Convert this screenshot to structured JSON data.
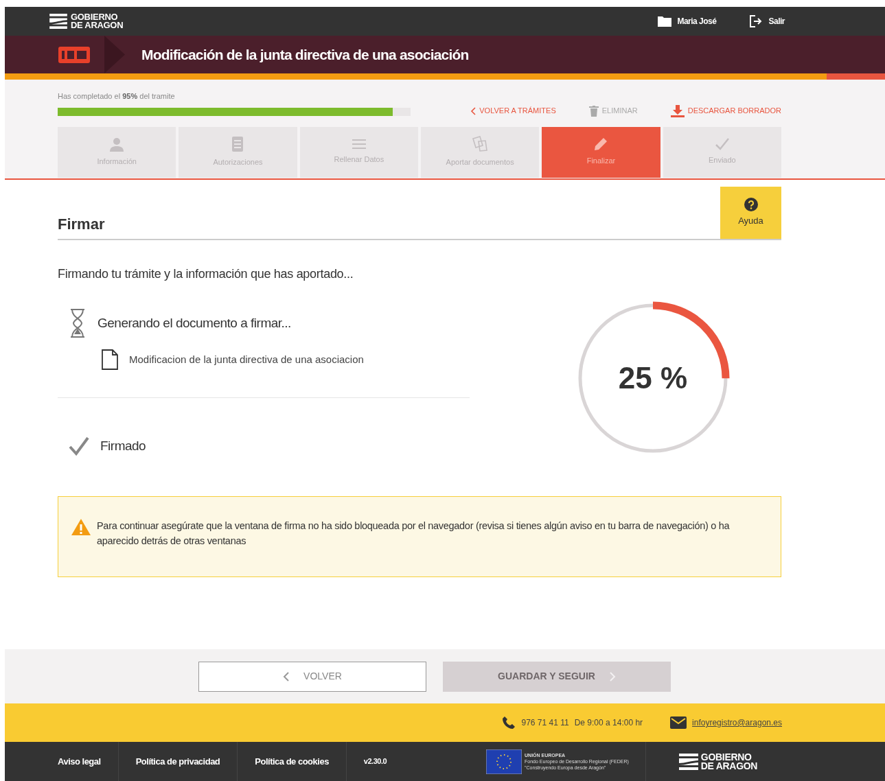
{
  "header": {
    "logo_line1": "GOBIERNO",
    "logo_line2": "DE ARAGON",
    "user": "Maria José",
    "logout": "Salir"
  },
  "title_bar": {
    "title": "Modificación de la junta directiva de una asociación"
  },
  "progress": {
    "text_before": "Has completado el ",
    "percent": "95%",
    "text_after": " del tramite",
    "level": 0.95
  },
  "actions": [
    {
      "kind": "back",
      "label": "VOLVER A TRÁMITES",
      "disabled": false
    },
    {
      "kind": "delete",
      "label": "ELIMINAR",
      "disabled": true
    },
    {
      "kind": "download",
      "label": "DESCARGAR BORRADOR",
      "disabled": false
    }
  ],
  "steps": [
    {
      "kind": "user",
      "label": "Información",
      "selected": false
    },
    {
      "kind": "doc",
      "label": "Autorizaciones",
      "selected": false
    },
    {
      "kind": "lines",
      "label": "Rellenar Datos",
      "selected": false
    },
    {
      "kind": "papers",
      "label": "Aportar documentos",
      "selected": false
    },
    {
      "kind": "pencil",
      "label": "Finalizar",
      "selected": true
    },
    {
      "kind": "check",
      "label": "Enviado",
      "selected": false
    }
  ],
  "help": {
    "label": "Ayuda"
  },
  "section_title": "Firmar",
  "intro": "Firmando tu trámite y la información que has aportado...",
  "tasks": [
    {
      "kind": "waiting",
      "label": "Generando el documento a firmar...",
      "document": "Modificacion de la junta directiva de una asociacion"
    },
    {
      "kind": "done",
      "label": "Firmado"
    }
  ],
  "gauge": {
    "label": "25 %",
    "level": 0.25
  },
  "warning": "Para continuar asegúrate que la ventana de firma no ha sido bloqueada por el navegador (revisa si tienes algún aviso en tu barra de navegación) o ha aparecido detrás de otras ventanas",
  "buttons": [
    {
      "kind": "back",
      "label": "VOLVER",
      "disabled": false
    },
    {
      "kind": "next",
      "label": "GUARDAR Y SEGUIR",
      "disabled": true
    }
  ],
  "contact": {
    "phone": "976 71 41 11",
    "hours": "De 9:00 a 14:00 hr",
    "email": "infoyregistro@aragon.es"
  },
  "footer_links": [
    "Aviso legal",
    "Política de privacidad",
    "Política de cookies"
  ],
  "version": "v2.30.0",
  "eu": {
    "title": "UNIÓN EUROPEA",
    "line1": "Fondo Europeo de Desarrollo Regional (FEDER)",
    "line2": "\"Construyendo Europa desde Aragón\""
  },
  "footer_logo": {
    "line1": "GOBIERNO",
    "line2": "DE ARAGON"
  }
}
